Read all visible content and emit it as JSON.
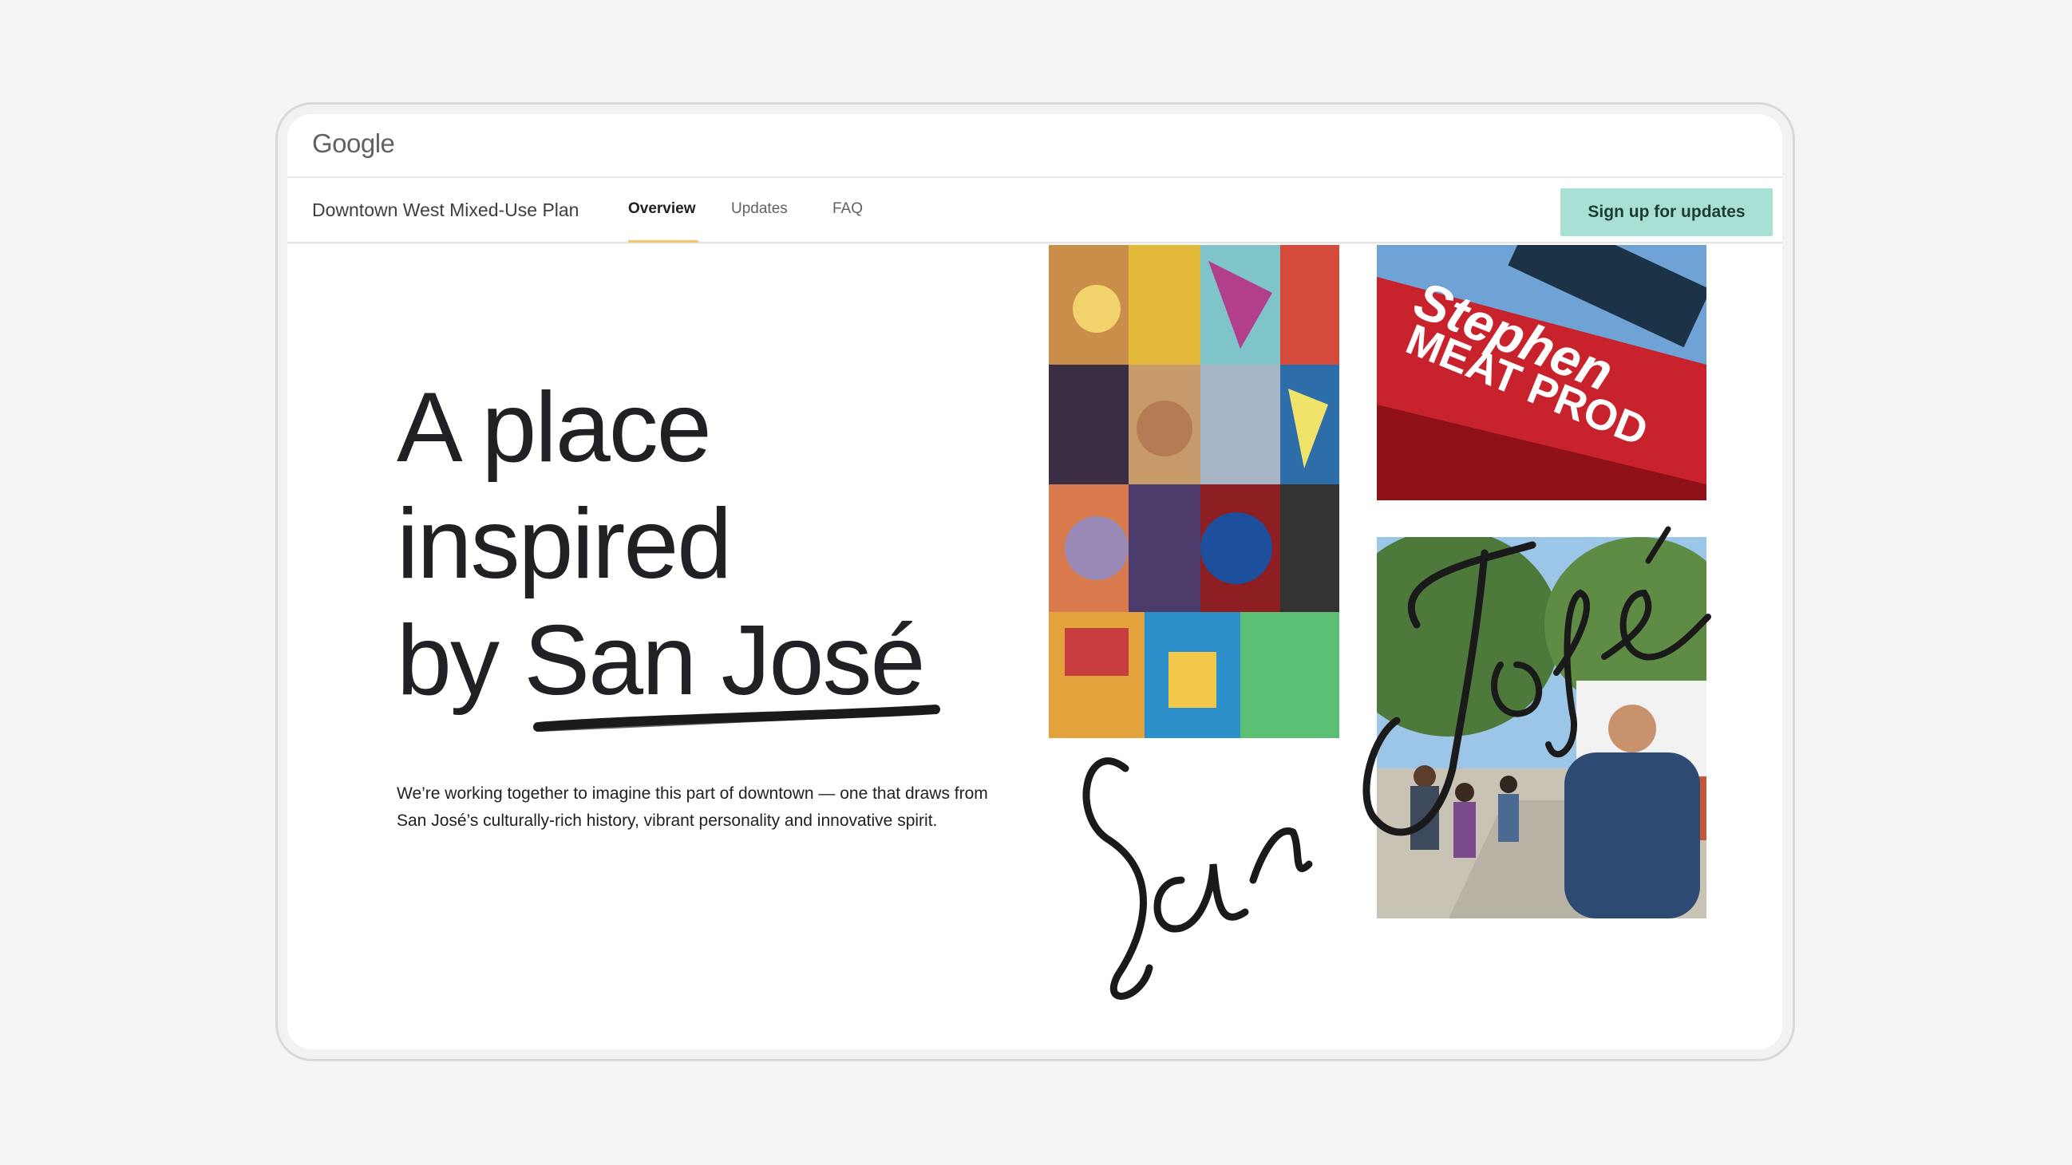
{
  "header": {
    "logo_text": "Google"
  },
  "nav": {
    "site_title": "Downtown West Mixed-Use Plan",
    "tabs": [
      {
        "label": "Overview",
        "active": true
      },
      {
        "label": "Updates",
        "active": false
      },
      {
        "label": "FAQ",
        "active": false
      }
    ],
    "cta_label": "Sign up for updates"
  },
  "hero": {
    "title_line1": "A place",
    "title_line2": "inspired",
    "title_line3": "by San José",
    "body": "We’re working together to imagine this part of downtown — one that draws from San José’s culturally-rich history, vibrant personality and innovative spirit."
  },
  "images": {
    "collage_icon": "mural-collage-image",
    "sign_icon": "neon-sign-image",
    "street_icon": "street-market-image",
    "sign_text_line1": "Stephen",
    "sign_text_line2": "MEAT PROD"
  },
  "colors": {
    "cta_bg": "#a8e0d6",
    "tab_underline": "#f6c46a",
    "text_dark": "#202124"
  }
}
